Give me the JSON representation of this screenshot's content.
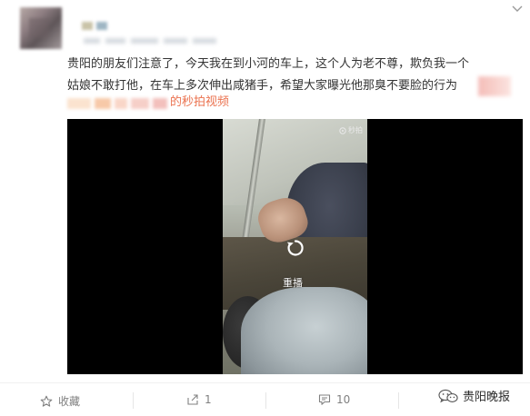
{
  "post": {
    "text": "贵阳的朋友们注意了，今天我在到小河的车上，这个人为老不尊，欺负我一个姑娘不敢打他，在车上多次伸出咸猪手，希望大家曝光他那臭不要脸的行为",
    "video_link": "的秒拍视频"
  },
  "video": {
    "watermark": "秒拍",
    "replay_label": "重播"
  },
  "actions": {
    "favorite_label": "收藏",
    "repost_count": "1",
    "comment_count": "10"
  },
  "badge": {
    "label": "贵阳晚报"
  },
  "colors": {
    "link": "#eb7350",
    "text": "#333333",
    "meta": "#808080"
  },
  "icons": [
    "more-chevron-icon",
    "replay-icon",
    "star-icon",
    "repost-icon",
    "comment-icon",
    "wechat-icon"
  ]
}
